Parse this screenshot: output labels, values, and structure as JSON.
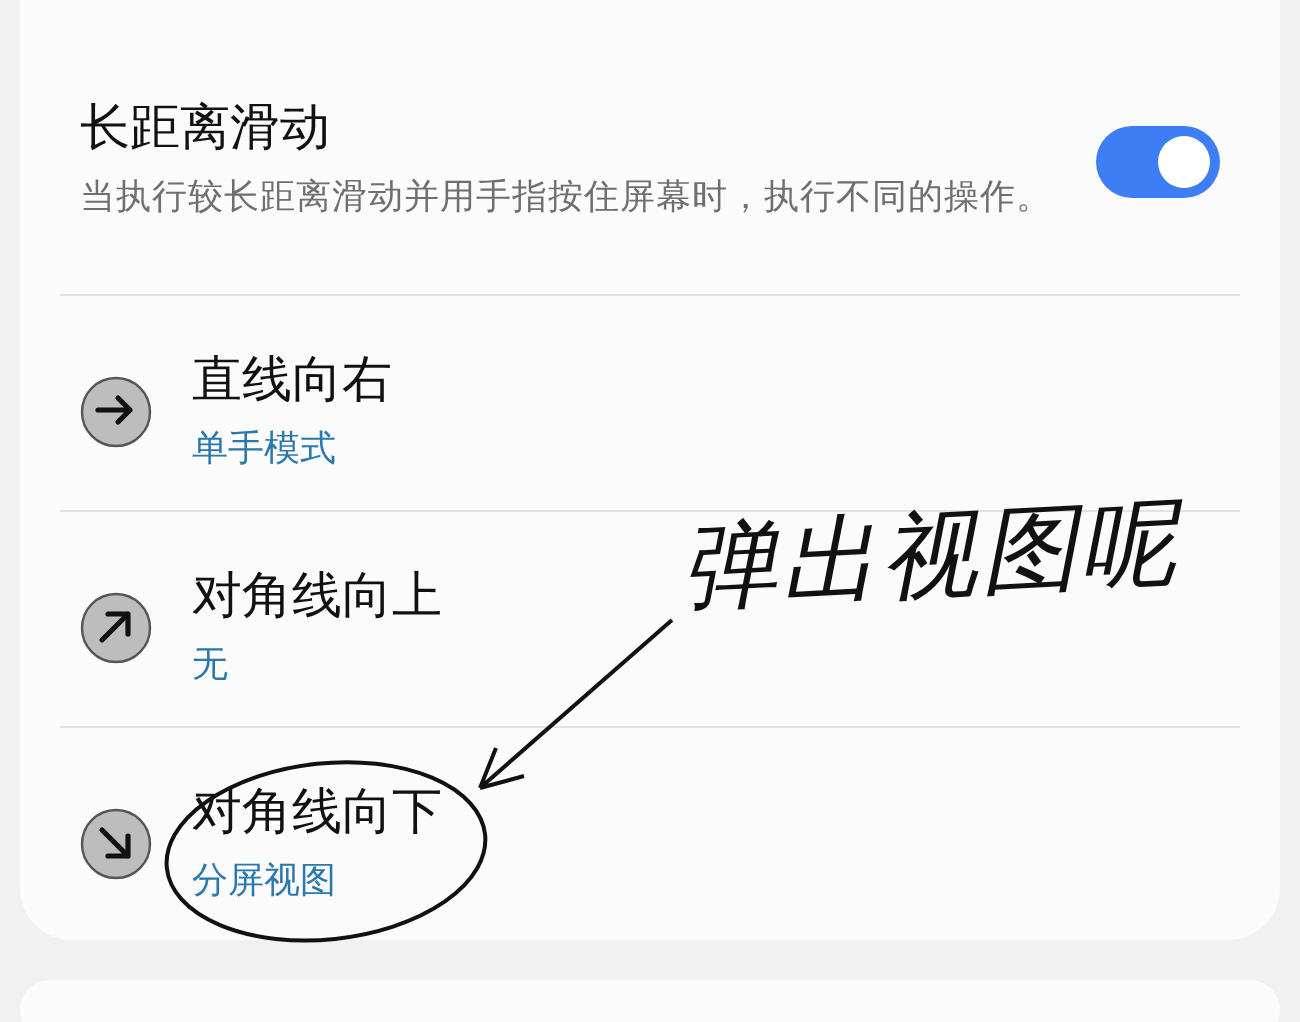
{
  "setting": {
    "title": "长距离滑动",
    "description": "当执行较长距离滑动并用手指按住屏幕时，执行不同的操作。",
    "on": true
  },
  "gestures": [
    {
      "kind": "right",
      "title": "直线向右",
      "value": "单手模式"
    },
    {
      "kind": "up-right",
      "title": "对角线向上",
      "value": "无"
    },
    {
      "kind": "down-right",
      "title": "对角线向下",
      "value": "分屏视图"
    }
  ],
  "annotation": {
    "text": "弹出视图呢"
  }
}
